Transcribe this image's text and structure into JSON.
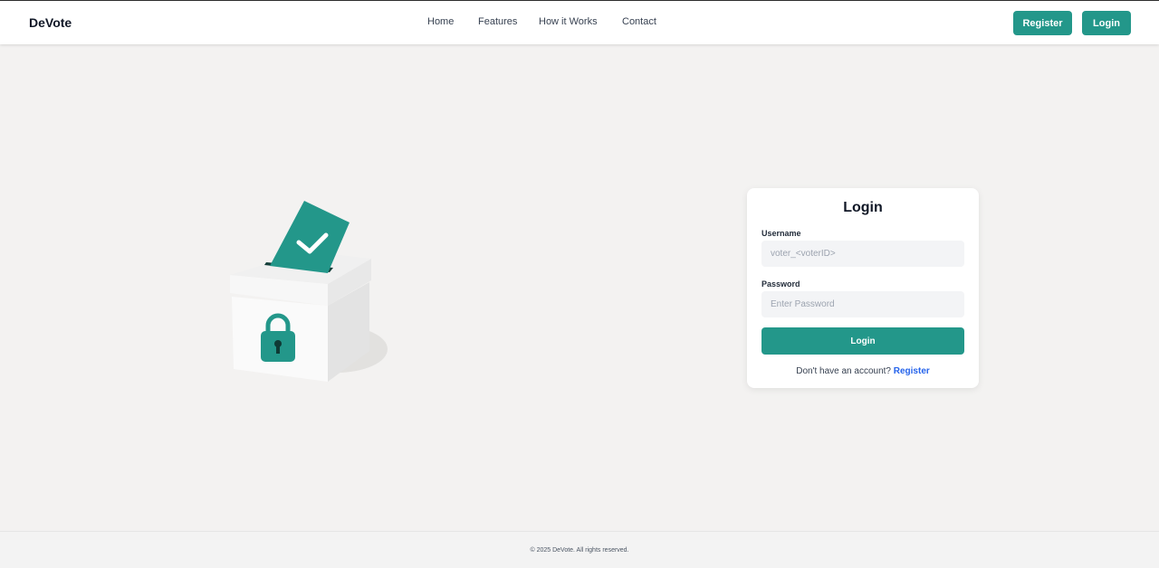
{
  "header": {
    "brand": "DeVote",
    "nav": [
      "Home",
      "Features",
      "How it Works",
      "Contact"
    ],
    "register_label": "Register",
    "login_label": "Login"
  },
  "hero": {
    "icons": [
      "ballot-box-icon",
      "ballot-paper-icon",
      "checkmark-icon",
      "padlock-icon"
    ]
  },
  "login_card": {
    "title": "Login",
    "username_label": "Username",
    "username_placeholder": "voter_<voterID>",
    "username_value": "",
    "password_label": "Password",
    "password_placeholder": "Enter Password",
    "password_value": "",
    "submit_label": "Login",
    "signup_prompt": "Don't have an account?",
    "signup_link": "Register"
  },
  "footer": {
    "copyright": "© 2025 DeVote. All rights reserved."
  },
  "colors": {
    "accent": "#23978a",
    "link": "#2563eb",
    "background": "#f3f2f1"
  }
}
